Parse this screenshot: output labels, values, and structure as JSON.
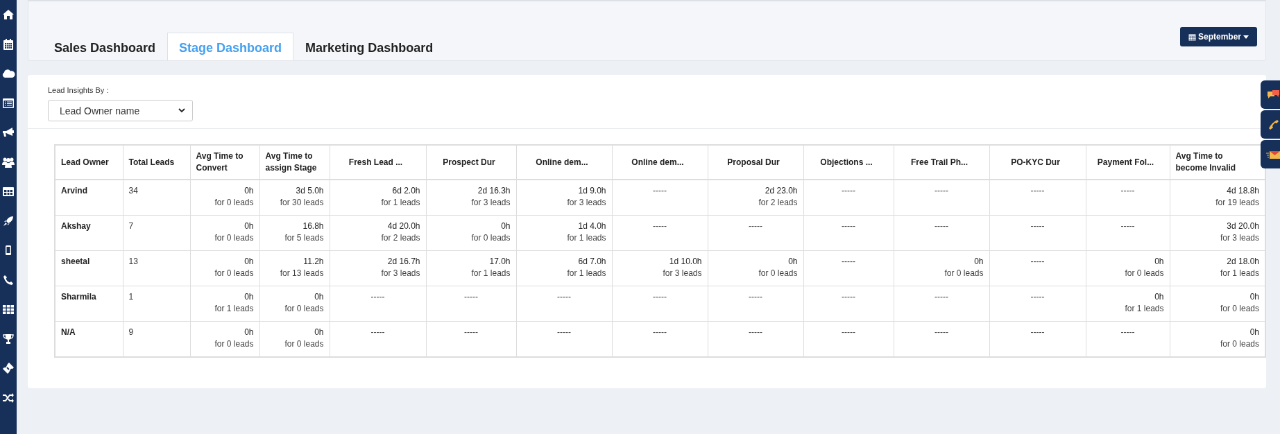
{
  "tabs": [
    {
      "label": "Sales Dashboard",
      "selected": false
    },
    {
      "label": "Stage Dashboard",
      "selected": true
    },
    {
      "label": "Marketing Dashboard",
      "selected": false
    }
  ],
  "month_button": {
    "label": "September"
  },
  "filter": {
    "label": "Lead Insights By :",
    "value": "Lead Owner name"
  },
  "table": {
    "columns": [
      "Lead Owner",
      "Total Leads",
      "Avg Time to Convert",
      "Avg Time to assign Stage",
      "Fresh Lead ...",
      "Prospect Dur",
      "Online dem...",
      "Online dem...",
      "Proposal Dur",
      "Objections ...",
      "Free Trail Ph...",
      "PO-KYC Dur",
      "Payment Fol...",
      "Avg Time to become Invalid"
    ],
    "rows": [
      {
        "cells": [
          {
            "kind": "owner",
            "value": "Arvind"
          },
          {
            "kind": "count",
            "value": "34"
          },
          {
            "kind": "time",
            "value": "0h",
            "sub": "for 0 leads"
          },
          {
            "kind": "time",
            "value": "3d 5.0h",
            "sub": "for 30 leads"
          },
          {
            "kind": "time",
            "value": "6d 2.0h",
            "sub": "for 1 leads"
          },
          {
            "kind": "time",
            "value": "2d 16.3h",
            "sub": "for 3 leads"
          },
          {
            "kind": "time",
            "value": "1d 9.0h",
            "sub": "for 3 leads"
          },
          {
            "kind": "empty",
            "value": "-----"
          },
          {
            "kind": "time",
            "value": "2d 23.0h",
            "sub": "for 2 leads"
          },
          {
            "kind": "empty",
            "value": "-----"
          },
          {
            "kind": "empty",
            "value": "-----"
          },
          {
            "kind": "empty",
            "value": "-----"
          },
          {
            "kind": "empty",
            "value": "-----"
          },
          {
            "kind": "time",
            "value": "4d 18.8h",
            "sub": "for 19 leads"
          }
        ]
      },
      {
        "cells": [
          {
            "kind": "owner",
            "value": "Akshay"
          },
          {
            "kind": "count",
            "value": "7"
          },
          {
            "kind": "time",
            "value": "0h",
            "sub": "for 0 leads"
          },
          {
            "kind": "time",
            "value": "16.8h",
            "sub": "for 5 leads"
          },
          {
            "kind": "time",
            "value": "4d 20.0h",
            "sub": "for 2 leads"
          },
          {
            "kind": "time",
            "value": "0h",
            "sub": "for 0 leads"
          },
          {
            "kind": "time",
            "value": "1d 4.0h",
            "sub": "for 1 leads"
          },
          {
            "kind": "empty",
            "value": "-----"
          },
          {
            "kind": "empty",
            "value": "-----"
          },
          {
            "kind": "empty",
            "value": "-----"
          },
          {
            "kind": "empty",
            "value": "-----"
          },
          {
            "kind": "empty",
            "value": "-----"
          },
          {
            "kind": "empty",
            "value": "-----"
          },
          {
            "kind": "time",
            "value": "3d 20.0h",
            "sub": "for 3 leads"
          }
        ]
      },
      {
        "cells": [
          {
            "kind": "owner",
            "value": "sheetal"
          },
          {
            "kind": "count",
            "value": "13"
          },
          {
            "kind": "time",
            "value": "0h",
            "sub": "for 0 leads"
          },
          {
            "kind": "time",
            "value": "11.2h",
            "sub": "for 13 leads"
          },
          {
            "kind": "time",
            "value": "2d 16.7h",
            "sub": "for 3 leads"
          },
          {
            "kind": "time",
            "value": "17.0h",
            "sub": "for 1 leads"
          },
          {
            "kind": "time",
            "value": "6d 7.0h",
            "sub": "for 1 leads"
          },
          {
            "kind": "time",
            "value": "1d 10.0h",
            "sub": "for 3 leads"
          },
          {
            "kind": "time",
            "value": "0h",
            "sub": "for 0 leads"
          },
          {
            "kind": "empty",
            "value": "-----"
          },
          {
            "kind": "time",
            "value": "0h",
            "sub": "for 0 leads"
          },
          {
            "kind": "empty",
            "value": "-----"
          },
          {
            "kind": "time",
            "value": "0h",
            "sub": "for 0 leads"
          },
          {
            "kind": "time",
            "value": "2d 18.0h",
            "sub": "for 1 leads"
          }
        ]
      },
      {
        "cells": [
          {
            "kind": "owner",
            "value": "Sharmila"
          },
          {
            "kind": "count",
            "value": "1"
          },
          {
            "kind": "time",
            "value": "0h",
            "sub": "for 1 leads"
          },
          {
            "kind": "time",
            "value": "0h",
            "sub": "for 0 leads"
          },
          {
            "kind": "empty",
            "value": "-----"
          },
          {
            "kind": "empty",
            "value": "-----"
          },
          {
            "kind": "empty",
            "value": "-----"
          },
          {
            "kind": "empty",
            "value": "-----"
          },
          {
            "kind": "empty",
            "value": "-----"
          },
          {
            "kind": "empty",
            "value": "-----"
          },
          {
            "kind": "empty",
            "value": "-----"
          },
          {
            "kind": "empty",
            "value": "-----"
          },
          {
            "kind": "time",
            "value": "0h",
            "sub": "for 1 leads"
          },
          {
            "kind": "time",
            "value": "0h",
            "sub": "for 0 leads"
          }
        ]
      },
      {
        "cells": [
          {
            "kind": "owner",
            "value": "N/A"
          },
          {
            "kind": "count",
            "value": "9"
          },
          {
            "kind": "time",
            "value": "0h",
            "sub": "for 0 leads"
          },
          {
            "kind": "time",
            "value": "0h",
            "sub": "for 0 leads"
          },
          {
            "kind": "empty",
            "value": "-----"
          },
          {
            "kind": "empty",
            "value": "-----"
          },
          {
            "kind": "empty",
            "value": "-----"
          },
          {
            "kind": "empty",
            "value": "-----"
          },
          {
            "kind": "empty",
            "value": "-----"
          },
          {
            "kind": "empty",
            "value": "-----"
          },
          {
            "kind": "empty",
            "value": "-----"
          },
          {
            "kind": "empty",
            "value": "-----"
          },
          {
            "kind": "empty",
            "value": "-----"
          },
          {
            "kind": "time",
            "value": "0h",
            "sub": "for 0 leads"
          }
        ]
      }
    ]
  }
}
